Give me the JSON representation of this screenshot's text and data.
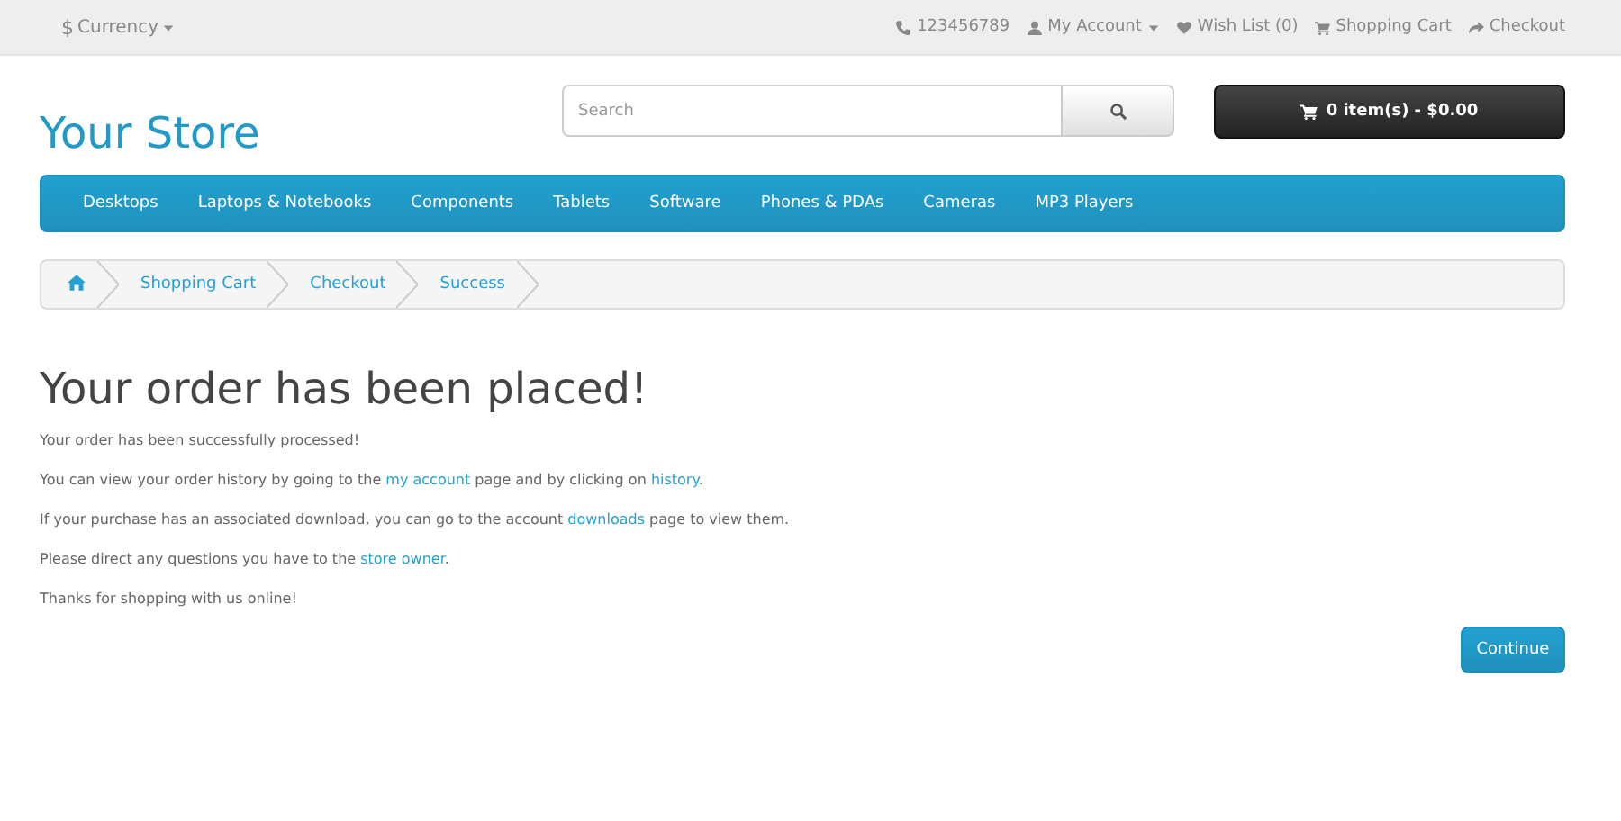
{
  "top_bar": {
    "currency": {
      "symbol": "$",
      "label": "Currency"
    },
    "links": [
      {
        "kind": "phone",
        "label": "123456789"
      },
      {
        "kind": "account",
        "label": "My Account"
      },
      {
        "kind": "wishlist",
        "label": "Wish List (0)"
      },
      {
        "kind": "cart",
        "label": "Shopping Cart"
      },
      {
        "kind": "checkout",
        "label": "Checkout"
      }
    ]
  },
  "header": {
    "logo": "Your Store",
    "search": {
      "placeholder": "Search"
    },
    "cart_button": "0 item(s) - $0.00"
  },
  "menu": [
    "Desktops",
    "Laptops & Notebooks",
    "Components",
    "Tablets",
    "Software",
    "Phones & PDAs",
    "Cameras",
    "MP3 Players"
  ],
  "breadcrumb": [
    {
      "kind": "home"
    },
    {
      "kind": "link",
      "label": "Shopping Cart"
    },
    {
      "kind": "link",
      "label": "Checkout"
    },
    {
      "kind": "link",
      "label": "Success"
    }
  ],
  "content": {
    "title": "Your order has been placed!",
    "paragraphs": [
      [
        {
          "kind": "text",
          "text": "Your order has been successfully processed!"
        }
      ],
      [
        {
          "kind": "text",
          "text": "You can view your order history by going to the "
        },
        {
          "kind": "link",
          "text": "my account"
        },
        {
          "kind": "text",
          "text": " page and by clicking on "
        },
        {
          "kind": "link",
          "text": "history"
        },
        {
          "kind": "text",
          "text": "."
        }
      ],
      [
        {
          "kind": "text",
          "text": "If your purchase has an associated download, you can go to the account "
        },
        {
          "kind": "link",
          "text": "downloads"
        },
        {
          "kind": "text",
          "text": " page to view them."
        }
      ],
      [
        {
          "kind": "text",
          "text": "Please direct any questions you have to the "
        },
        {
          "kind": "link",
          "text": "store owner"
        },
        {
          "kind": "text",
          "text": "."
        }
      ],
      [
        {
          "kind": "text",
          "text": "Thanks for shopping with us online!"
        }
      ]
    ],
    "button": "Continue"
  }
}
